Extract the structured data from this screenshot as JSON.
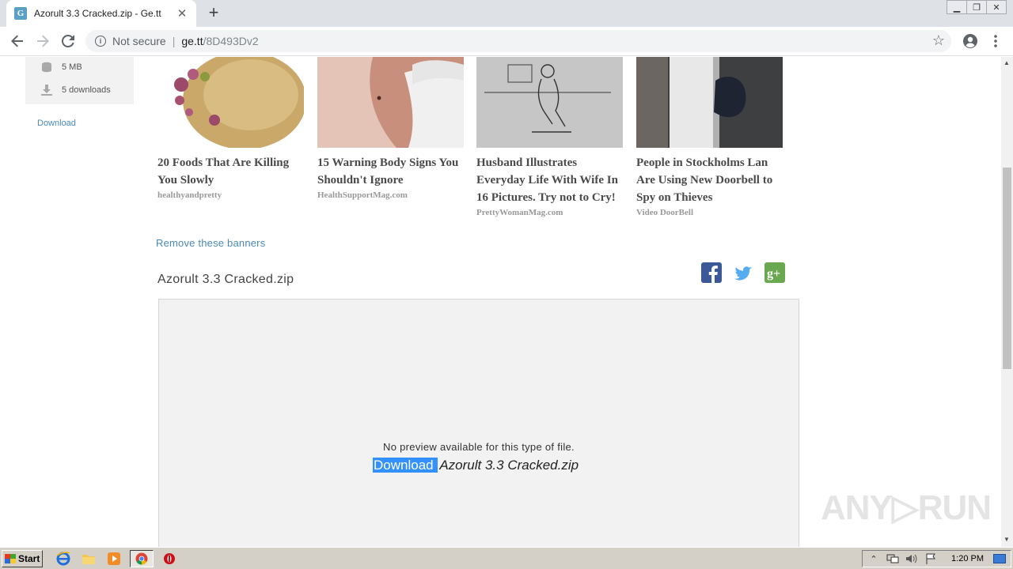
{
  "browser": {
    "tab_title": "Azorult 3.3 Cracked.zip - Ge.tt",
    "tab_favicon_letter": "G",
    "new_tab": "+",
    "close": "✕",
    "security_label": "Not secure",
    "url_host": "ge.tt",
    "url_path": "/8D493Dv2"
  },
  "sidebar": {
    "size": "5 MB",
    "downloads": "5 downloads",
    "download_link": "Download"
  },
  "ads": [
    {
      "title": "20 Foods That Are Killing You Slowly",
      "source": "healthyandpretty"
    },
    {
      "title": "15 Warning Body Signs You Shouldn't Ignore",
      "source": "HealthSupportMag.com"
    },
    {
      "title": "Husband Illustrates Everyday Life With Wife In 16 Pictures. Try not to Cry!",
      "source": "PrettyWomanMag.com"
    },
    {
      "title": "People in Stockholms Lan Are Using New Doorbell to Spy on Thieves",
      "source": "Video DoorBell"
    }
  ],
  "remove_banners": "Remove these banners",
  "file": {
    "title": "Azorult 3.3 Cracked.zip",
    "no_preview": "No preview available for this type of file.",
    "download_label": "Download ",
    "file_name": "Azorult 3.3 Cracked.zip"
  },
  "social": [
    "facebook-icon",
    "twitter-icon",
    "google-plus-icon"
  ],
  "watermark": "ANY▷RUN",
  "taskbar": {
    "start": "Start",
    "clock": "1:20 PM"
  },
  "colors": {
    "link": "#4a8ab8",
    "selection": "#3390ff",
    "facebook": "#3b5998",
    "twitter": "#55acee",
    "google_plus": "#dd4b39"
  }
}
